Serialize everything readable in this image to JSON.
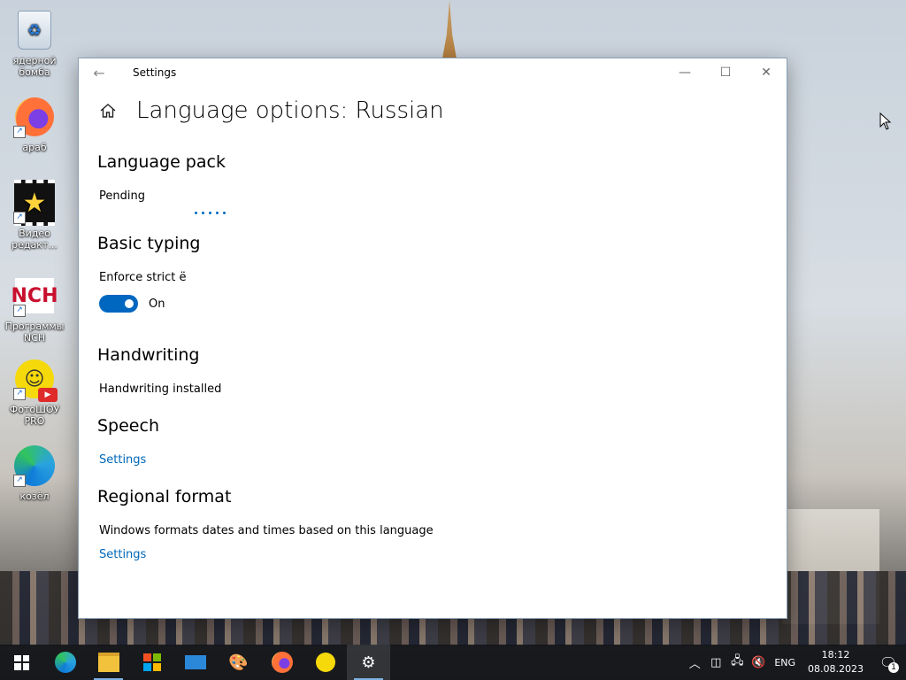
{
  "desktop": {
    "icons": [
      {
        "label": "ядерной бомба",
        "icon": "recycle-bin-icon"
      },
      {
        "label": "араб",
        "icon": "firefox-icon"
      },
      {
        "label": "Видео редакт...",
        "icon": "video-editor-icon"
      },
      {
        "label": "Программы NCH",
        "icon": "nch-icon"
      },
      {
        "label": "ФотоШОУ PRO",
        "icon": "fotoshow-icon"
      },
      {
        "label": "козёл",
        "icon": "edge-icon"
      }
    ]
  },
  "window": {
    "title": "Settings",
    "page_title": "Language options: Russian",
    "sections": {
      "language_pack": {
        "heading": "Language pack",
        "status": "Pending"
      },
      "basic_typing": {
        "heading": "Basic typing",
        "option_label": "Enforce strict ё",
        "toggle_state": "On"
      },
      "handwriting": {
        "heading": "Handwriting",
        "status": "Handwriting installed"
      },
      "speech": {
        "heading": "Speech",
        "link": "Settings"
      },
      "regional_format": {
        "heading": "Regional format",
        "description": "Windows formats dates and times based on this language",
        "link": "Settings"
      }
    }
  },
  "taskbar": {
    "language": "ENG",
    "time": "18:12",
    "date": "08.08.2023",
    "notification_count": "1"
  }
}
